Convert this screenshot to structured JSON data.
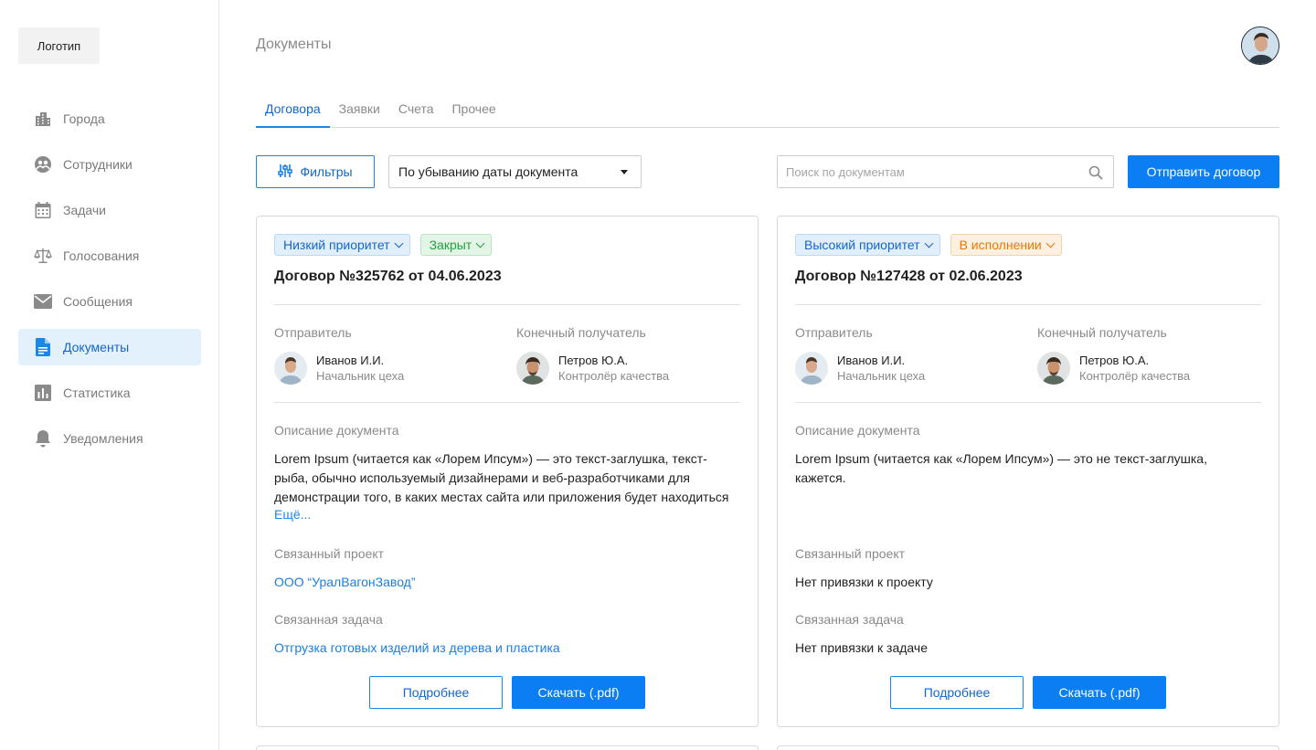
{
  "sidebar": {
    "logo": "Логотип",
    "items": [
      {
        "label": "Города",
        "icon": "buildings-icon"
      },
      {
        "label": "Сотрудники",
        "icon": "people-icon"
      },
      {
        "label": "Задачи",
        "icon": "calendar-icon"
      },
      {
        "label": "Голосования",
        "icon": "scales-icon"
      },
      {
        "label": "Сообщения",
        "icon": "envelope-icon"
      },
      {
        "label": "Документы",
        "icon": "document-icon",
        "active": true
      },
      {
        "label": "Статистика",
        "icon": "bar-chart-icon"
      },
      {
        "label": "Уведомления",
        "icon": "bell-icon"
      }
    ]
  },
  "header": {
    "title": "Документы"
  },
  "tabs": [
    {
      "label": "Договора",
      "active": true
    },
    {
      "label": "Заявки"
    },
    {
      "label": "Счета"
    },
    {
      "label": "Прочее"
    }
  ],
  "toolbar": {
    "filters_label": "Фильтры",
    "sort_value": "По убыванию даты документа",
    "search_placeholder": "Поиск по документам",
    "send_label": "Отправить договор"
  },
  "colors": {
    "accent": "#0a7ef2",
    "active_nav_bg": "#e3f1fd",
    "priority_badge": "#e1effc",
    "closed_badge": "#e2f5e6",
    "in_progress_badge": "#fdf0e1"
  },
  "cards": [
    {
      "priority": "Низкий приоритет",
      "status": "Закрыт",
      "title": "Договор №325762 от 04.06.2023",
      "sender_label": "Отправитель",
      "sender_name": "Иванов И.И.",
      "sender_role": "Начальник цеха",
      "recipient_label": "Конечный получатель",
      "recipient_name": "Петров Ю.А.",
      "recipient_role": "Контролёр качества",
      "description_label": "Описание документа",
      "description": "Lorem Ipsum (читается как «Лорем Ипсум») — это текст-заглушка, текст-рыба, обычно используемый дизайнерами и веб-разработчиками для демонстрации того, в каких местах сайта или приложения будет находиться",
      "more_label": "Ещё...",
      "project_label": "Связанный проект",
      "project": "ООО “УралВагонЗавод”",
      "task_label": "Связанная задача",
      "task": "Отгрузка готовых изделий из дерева и пластика",
      "details_label": "Подробнее",
      "download_label": "Скачать (.pdf)"
    },
    {
      "priority": "Высокий приоритет",
      "status": "В исполнении",
      "title": "Договор №127428 от 02.06.2023",
      "sender_label": "Отправитель",
      "sender_name": "Иванов И.И.",
      "sender_role": "Начальник цеха",
      "recipient_label": "Конечный получатель",
      "recipient_name": "Петров Ю.А.",
      "recipient_role": "Контролёр качества",
      "description_label": "Описание документа",
      "description": "Lorem Ipsum (читается как «Лорем Ипсум») — это не текст-заглушка, кажется.",
      "project_label": "Связанный проект",
      "project": "Нет привязки к проекту",
      "task_label": "Связанная задача",
      "task": "Нет привязки к задаче",
      "details_label": "Подробнее",
      "download_label": "Скачать (.pdf)"
    }
  ]
}
